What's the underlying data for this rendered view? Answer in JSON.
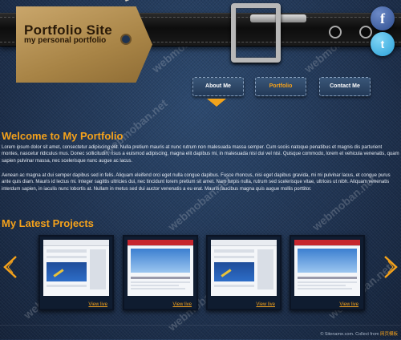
{
  "header": {
    "site_title": "Portfolio Site",
    "site_subtitle": "my personal portfolio",
    "social": [
      {
        "icon": "facebook-icon",
        "glyph": "f"
      },
      {
        "icon": "twitter-icon",
        "glyph": "t"
      }
    ]
  },
  "nav": {
    "items": [
      {
        "label": "About Me"
      },
      {
        "label": "Portfolio",
        "active": true
      },
      {
        "label": "Contact Me"
      }
    ]
  },
  "welcome": {
    "title": "Welcome to My Portfolio",
    "paragraph_1": "Lorem ipsum dolor sit amet, consectetur adipiscing elit. Nulla pretium mauris at nunc rutrum non malesuada massa semper. Cum sociis natoque penatibus et magnis dis parturient montes, nascetur ridiculus mus. Donec sollicitudin, risus a euismod adipiscing, magna elit dapibus mi, in malesuada nisl dui vel nisi. Quisque commodo, lorem et vehicula venenatis, quam sapien pulvinar massa, nec scelerisque nunc augue ac lacus.",
    "paragraph_2": "Aenean ac magna at dui semper dapibus sed in felis. Aliquam eleifend orci eget nulla congue dapibus. Fusce rhoncus, nisi eget dapibus gravida, mi mi pulvinar lacus, et congue purus ante quis diam. Mauris id lectus mi. Integer sagittis ultricies dui, nec tincidunt lorem pretium sit amet. Nam turpis nulla, rutrum sed scelerisque vitae, ultrices ut nibh. Aliquam venenatis interdum sapien, in iaculis nunc lobortis at. Nullam in metus sed dui auctor venenatis a eu erat. Mauris faucibus magna quis augue mollis porttitor."
  },
  "projects": {
    "title": "My Latest Projects",
    "view_label": "View live",
    "cards": [
      {
        "variant": "a"
      },
      {
        "variant": "b"
      },
      {
        "variant": "a"
      },
      {
        "variant": "b"
      }
    ]
  },
  "footer": {
    "copyright": "© Sitename.com. Collect from ",
    "link": "网页模板"
  },
  "watermark": "webmoban.net",
  "colors": {
    "accent": "#f5a21b",
    "denim": "#1f3350",
    "belt": "#111111"
  }
}
